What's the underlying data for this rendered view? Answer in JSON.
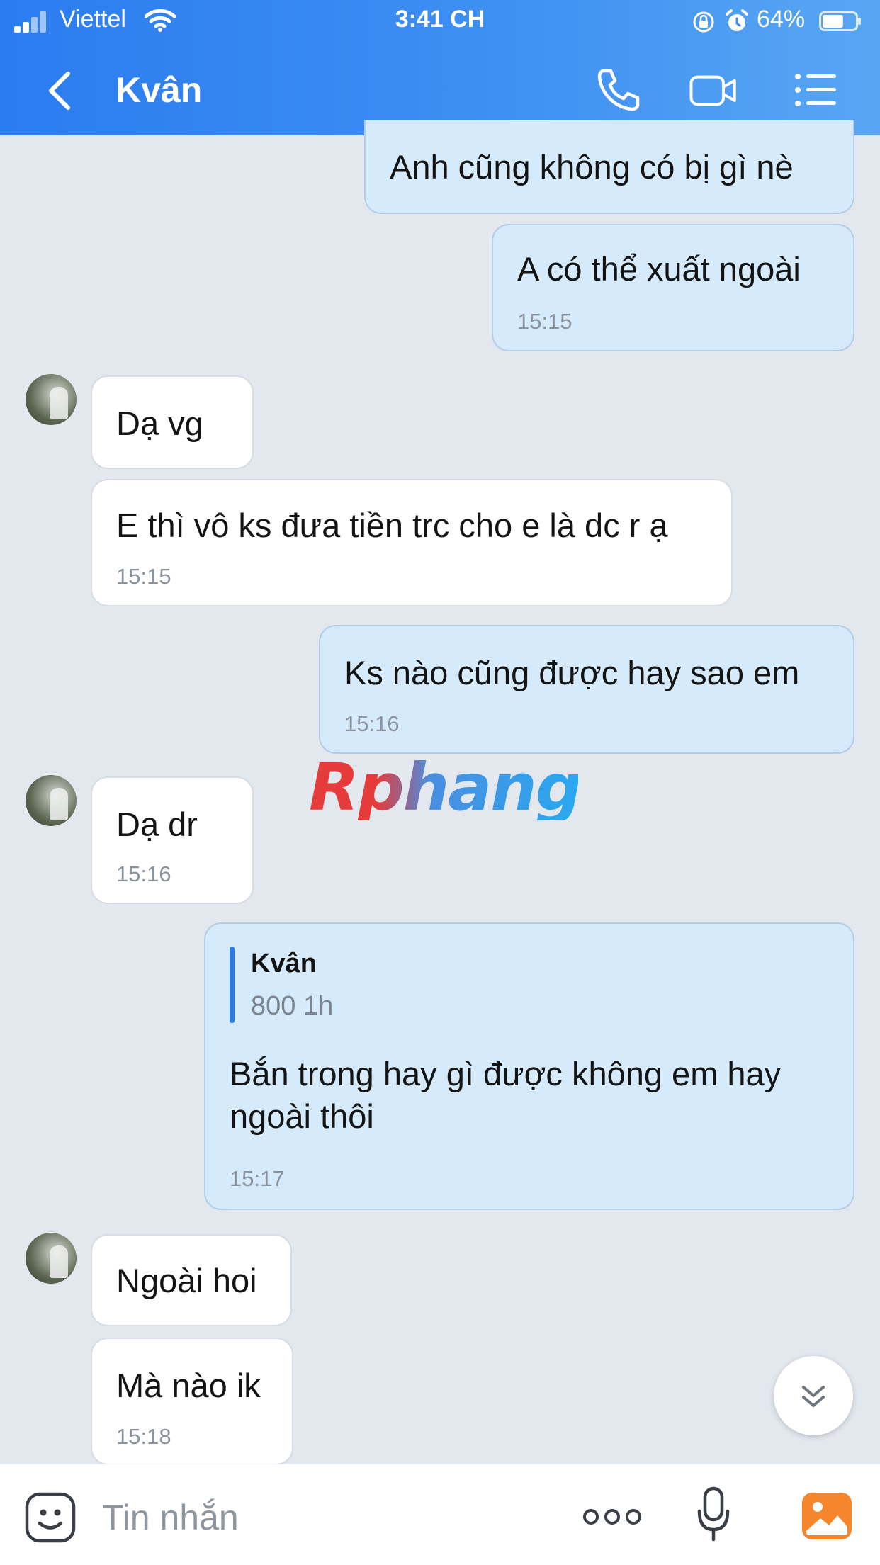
{
  "status_bar": {
    "carrier": "Viettel",
    "time": "3:41 CH",
    "battery": "64%",
    "battery_level": 0.64
  },
  "header": {
    "contact_name": "Kvân",
    "icons": [
      "back-chevron-icon",
      "phone-icon",
      "video-call-icon",
      "list-menu-icon"
    ]
  },
  "messages": [
    {
      "side": "out",
      "text": "Anh cũng không có bị gì nè",
      "time": ""
    },
    {
      "side": "out",
      "text": "A có thể xuất ngoài",
      "time": "15:15"
    },
    {
      "side": "in",
      "text": "Dạ vg",
      "time": ""
    },
    {
      "side": "in",
      "text": "E thì vô ks đưa tiền trc cho e là dc r ạ",
      "time": "15:15"
    },
    {
      "side": "out",
      "text": "Ks nào cũng được hay sao em",
      "time": "15:16"
    },
    {
      "side": "in",
      "text": "Dạ dr",
      "time": "15:16"
    },
    {
      "side": "out",
      "quote": {
        "name": "Kvân",
        "text": "800 1h"
      },
      "text": "Bắn trong hay gì được không em hay\nngoài thôi",
      "time": "15:17"
    },
    {
      "side": "in",
      "text": "Ngoài hoi",
      "time": ""
    },
    {
      "side": "in",
      "text": "Mà nào ik",
      "time": "15:18"
    }
  ],
  "watermark": "Rphang",
  "composer": {
    "placeholder": "Tin nhắn",
    "icons": [
      "sticker-icon",
      "more-options-icon",
      "microphone-icon",
      "gallery-icon"
    ]
  },
  "colors": {
    "header_start": "#2b7cf0",
    "header_end": "#58a6f3",
    "outgoing_bubble": "#d5eafb",
    "incoming_bubble": "#ffffff",
    "background": "#e3e7ee",
    "accent": "#2c7be5",
    "gallery_orange": "#f7852b"
  }
}
